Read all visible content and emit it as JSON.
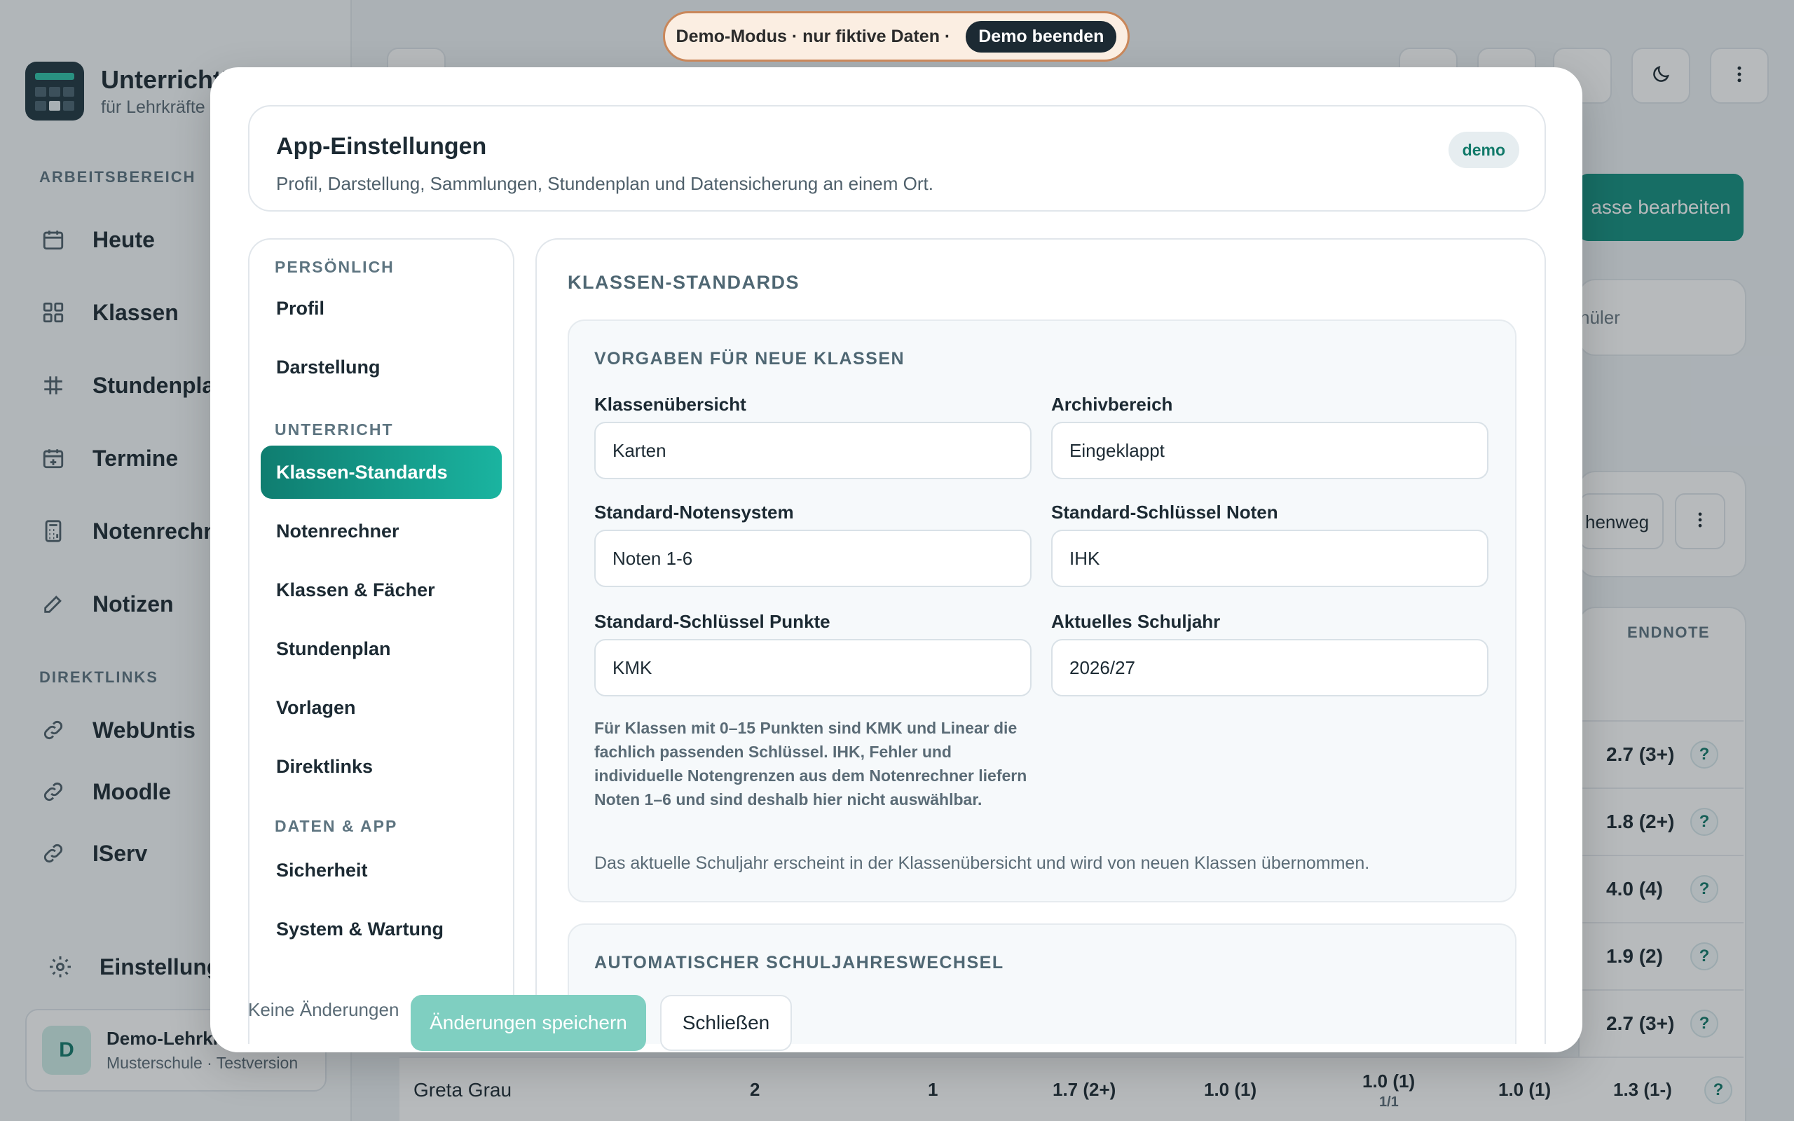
{
  "demo_banner": {
    "text": "Demo-Modus · nur fiktive Daten ·",
    "button": "Demo beenden"
  },
  "brand": {
    "title": "UnterrichtP",
    "subtitle": "für Lehrkräfte"
  },
  "sidebar": {
    "section_work": "ARBEITSBEREICH",
    "items": [
      {
        "label": "Heute",
        "icon": "calendar-icon"
      },
      {
        "label": "Klassen",
        "icon": "grid-icon"
      },
      {
        "label": "Stundenplan",
        "icon": "timetable-icon"
      },
      {
        "label": "Termine",
        "icon": "calendar-plus-icon"
      },
      {
        "label": "Notenrechn",
        "icon": "calculator-icon"
      },
      {
        "label": "Notizen",
        "icon": "pencil-icon"
      }
    ],
    "section_links": "DIREKTLINKS",
    "links": [
      {
        "label": "WebUntis",
        "icon": "link-icon"
      },
      {
        "label": "Moodle",
        "icon": "link-icon"
      },
      {
        "label": "IServ",
        "icon": "link-icon"
      }
    ],
    "settings_label": "Einstellunge",
    "user": {
      "initial": "D",
      "name": "Demo-Lehrkr",
      "school": "Musterschule · Testversion"
    }
  },
  "background": {
    "edit_class_button": "asse bearbeiten",
    "search_placeholder": "nüler",
    "filter_button": "henweg",
    "column_endnote": "ENDNOTE",
    "grades": [
      "2.7 (3+)",
      "1.8 (2+)",
      "4.0 (4)",
      "1.9 (2)",
      "2.7 (3+)"
    ],
    "student_row": {
      "name": "Greta Grau",
      "cells": [
        "2",
        "1",
        "1.7 (2+)",
        "1.0 (1)",
        "1.0 (1)",
        "1/1",
        "1.0 (1)",
        "1.3 (1-)"
      ]
    }
  },
  "modal": {
    "title": "App-Einstellungen",
    "subtitle": "Profil, Darstellung, Sammlungen, Stundenplan und Datensicherung an einem Ort.",
    "badge": "demo",
    "nav": {
      "section_personal": "PERSÖNLICH",
      "profil": "Profil",
      "darstellung": "Darstellung",
      "section_teaching": "UNTERRICHT",
      "klassen_standards": "Klassen-Standards",
      "notenrechner": "Notenrechner",
      "klassen_faecher": "Klassen & Fächer",
      "stundenplan": "Stundenplan",
      "vorlagen": "Vorlagen",
      "direktlinks": "Direktlinks",
      "section_data": "DATEN & APP",
      "sicherheit": "Sicherheit",
      "system_wartung": "System & Wartung"
    },
    "content": {
      "heading": "KLASSEN-STANDARDS",
      "card_title": "VORGABEN FÜR NEUE KLASSEN",
      "fields": {
        "overview_label": "Klassenübersicht",
        "overview_value": "Karten",
        "archive_label": "Archivbereich",
        "archive_value": "Eingeklappt",
        "grade_system_label": "Standard-Notensystem",
        "grade_system_value": "Noten 1-6",
        "grade_key_label": "Standard-Schlüssel Noten",
        "grade_key_value": "IHK",
        "points_key_label": "Standard-Schlüssel Punkte",
        "points_key_value": "KMK",
        "school_year_label": "Aktuelles Schuljahr",
        "school_year_value": "2026/27"
      },
      "hint": "Für Klassen mit 0–15 Punkten sind KMK und Linear die fachlich passenden Schlüssel. IHK, Fehler und individuelle Notengrenzen aus dem Notenrechner liefern Noten 1–6 und sind deshalb hier nicht auswählbar.",
      "note": "Das aktuelle Schuljahr erscheint in der Klassenübersicht und wird von neuen Klassen übernommen.",
      "next_card_title": "AUTOMATISCHER SCHULJAHRESWECHSEL"
    },
    "footer": {
      "status": "Keine Änderungen",
      "save": "Änderungen speichern",
      "close": "Schließen"
    }
  }
}
